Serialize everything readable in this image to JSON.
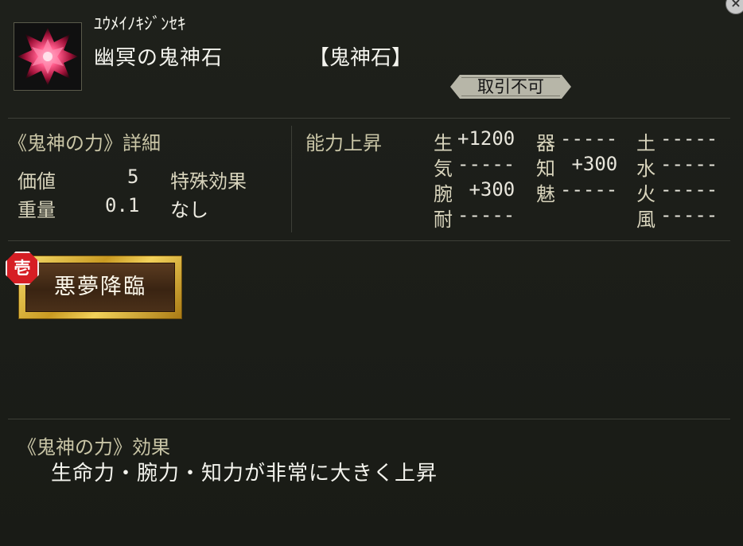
{
  "item": {
    "reading": "ﾕｳﾒｲﾉｷｼﾞﾝｾｷ",
    "name": "幽冥の鬼神石",
    "category": "【鬼神石】",
    "trade_status": "取引不可",
    "icon": "crimson-crystal-icon"
  },
  "detail": {
    "heading": "《鬼神の力》詳細",
    "value_label": "価値",
    "value": "5",
    "weight_label": "重量",
    "weight": "0.1",
    "special_label": "特殊効果",
    "special_value": "なし"
  },
  "abilities": {
    "heading": "能力上昇",
    "stats": [
      {
        "label": "生",
        "value": "+1200"
      },
      {
        "label": "器",
        "value": "-----"
      },
      {
        "label": "土",
        "value": "-----"
      },
      {
        "label": "気",
        "value": "-----"
      },
      {
        "label": "知",
        "value": " +300"
      },
      {
        "label": "水",
        "value": "-----"
      },
      {
        "label": "腕",
        "value": " +300"
      },
      {
        "label": "魅",
        "value": "-----"
      },
      {
        "label": "火",
        "value": "-----"
      },
      {
        "label": "耐",
        "value": "-----"
      },
      {
        "label": "風",
        "value": "-----"
      }
    ]
  },
  "skill": {
    "rank": "壱",
    "name": "悪夢降臨"
  },
  "effect": {
    "heading": "《鬼神の力》効果",
    "text": "生命力・腕力・知力が非常に大きく上昇"
  },
  "colors": {
    "background": "#1b1d18",
    "label_gold": "#c9c5a6",
    "badge_red": "#d61e24",
    "button_gold": "#e8c440"
  }
}
